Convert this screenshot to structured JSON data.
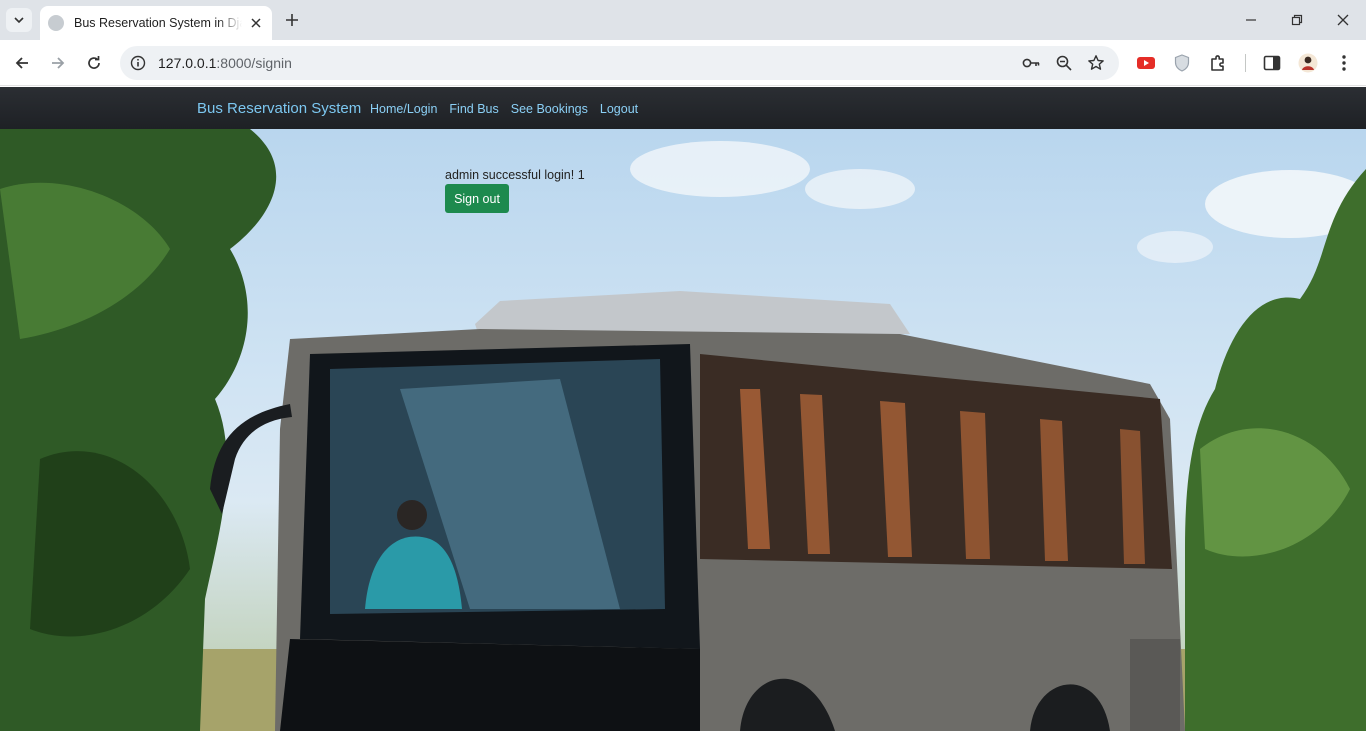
{
  "browser": {
    "tab": {
      "title": "Bus Reservation System in Django"
    },
    "url": {
      "host": "127.0.0.1",
      "path": ":8000/signin"
    }
  },
  "navbar": {
    "brand": "Bus Reservation System",
    "links": [
      {
        "label": "Home/Login"
      },
      {
        "label": "Find Bus"
      },
      {
        "label": "See Bookings"
      },
      {
        "label": "Logout"
      }
    ],
    "link_color": "#8bd0f6",
    "background": "#212529"
  },
  "main": {
    "message": "admin successful login! 1",
    "signout_label": "Sign out",
    "signout_color": "#1d8a4e"
  }
}
